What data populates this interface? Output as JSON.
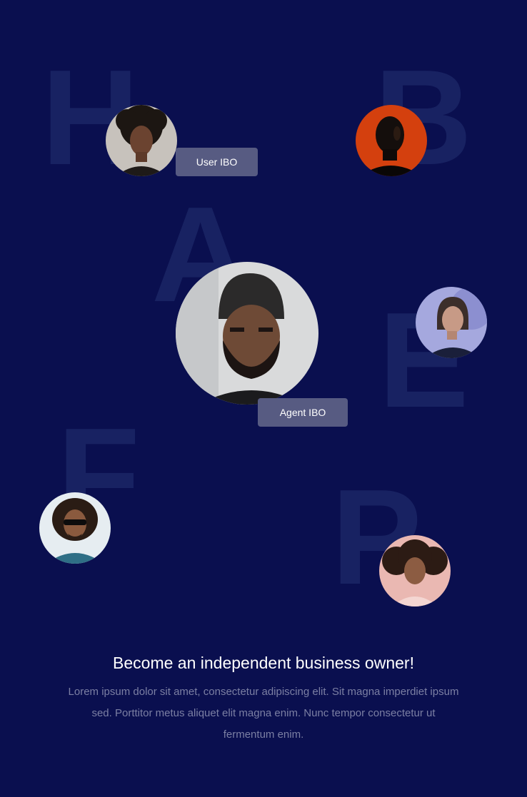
{
  "background_letters": [
    "H",
    "B",
    "A",
    "E",
    "F",
    "P"
  ],
  "tags": {
    "user": "User IBO",
    "agent": "Agent IBO"
  },
  "headline": "Become an independent business owner!",
  "body": "Lorem ipsum dolor sit amet, consectetur adipiscing elit. Sit magna imperdiet ipsum sed. Porttitor metus aliquet elit magna enim. Nunc tempor consectetur ut fermentum enim.",
  "colors": {
    "background": "#0a0f4f",
    "letter": "#182262",
    "tag": "#575b82",
    "headline": "#ffffff",
    "body": "#7b7fa3"
  }
}
